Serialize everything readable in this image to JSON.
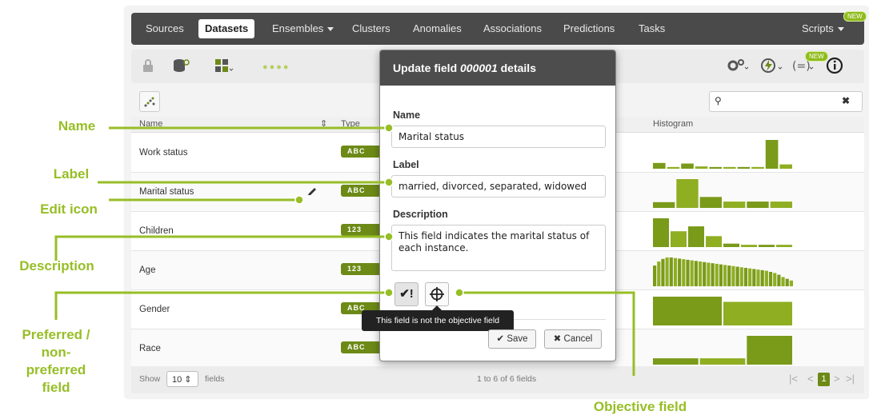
{
  "nav": {
    "items": [
      "Sources",
      "Datasets",
      "Ensembles",
      "Clusters",
      "Anomalies",
      "Associations",
      "Predictions",
      "Tasks"
    ],
    "active": "Datasets",
    "scripts_label": "Scripts",
    "new_badge": "NEW"
  },
  "toolbar": {
    "icons": [
      "lock-icon",
      "dataset-search-icon",
      "field-select-icon",
      "more-dots-icon",
      "gears-icon",
      "lightning-icon",
      "formula-icon",
      "info-icon"
    ],
    "new_badge": "NEW"
  },
  "table": {
    "headers": [
      "Name",
      "Type",
      "Histogram"
    ],
    "rows": [
      {
        "name": "Work status",
        "type": "ABC"
      },
      {
        "name": "Marital status",
        "type": "ABC"
      },
      {
        "name": "Children",
        "type": "123"
      },
      {
        "name": "Age",
        "type": "123"
      },
      {
        "name": "Gender",
        "type": "ABC"
      },
      {
        "name": "Race",
        "type": "ABC"
      }
    ],
    "histograms": [
      [
        0.2,
        0.06,
        0.18,
        0.08,
        0.06,
        0.06,
        0.06,
        0.06,
        1.0,
        0.15
      ],
      [
        0.2,
        1.0,
        0.38,
        0.22,
        0.22,
        0.22
      ],
      [
        1.0,
        0.55,
        0.72,
        0.38,
        0.12,
        0.08,
        0.08,
        0.08
      ],
      [
        0.72,
        0.86,
        0.95,
        1.0,
        1.0,
        0.98,
        0.96,
        0.94,
        0.92,
        0.9,
        0.88,
        0.86,
        0.84,
        0.82,
        0.8,
        0.78,
        0.76,
        0.74,
        0.72,
        0.7,
        0.68,
        0.66,
        0.64,
        0.62,
        0.6,
        0.58,
        0.56,
        0.54,
        0.5,
        0.46,
        0.4,
        0.32,
        0.26,
        0.2
      ],
      [
        1.0,
        0.82
      ],
      [
        0.22,
        0.22,
        1.0
      ]
    ],
    "histogram_color": "#7a9a1a"
  },
  "footer": {
    "show_label": "Show",
    "page_size": "10",
    "fields_label": "fields",
    "range_text": "1 to 6 of 6 fields",
    "current_page": "1"
  },
  "modal": {
    "title_prefix": "Update field ",
    "title_id": "000001",
    "title_suffix": " details",
    "name_label": "Name",
    "name_value": "Marital status",
    "label_label": "Label",
    "label_value": "married, divorced, separated, widowed",
    "description_label": "Description",
    "description_value": "This field indicates the marital status of each instance.",
    "tooltip": "This field is not the objective field",
    "save_label": "Save",
    "cancel_label": "Cancel"
  },
  "callouts": {
    "name": "Name",
    "label": "Label",
    "edit_icon": "Edit icon",
    "description": "Description",
    "preferred_lines": [
      "Preferred /",
      "non-",
      "preferred",
      "field"
    ],
    "objective": "Objective field"
  },
  "colors": {
    "accent": "#97be26",
    "nav_bg": "#4a4a4a",
    "pill": "#6d8a17"
  }
}
